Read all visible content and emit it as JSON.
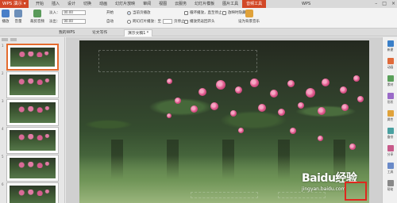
{
  "app": {
    "name": "WPS 演示",
    "wps_badge": "WPS"
  },
  "menu": {
    "tabs": [
      "开始",
      "插入",
      "设计",
      "切换",
      "动画",
      "幻灯片放映",
      "审阅",
      "视图",
      "云服务",
      "幻灯片模板",
      "图片工具",
      "音频工具"
    ],
    "active": "音频工具"
  },
  "ribbon": {
    "play": "播放",
    "volume": "音量",
    "trim": "裁剪音频",
    "fade_in_label": "淡入：",
    "fade_in_value": "00.00",
    "fade_out_label": "淡出：",
    "fade_out_value": "00.00",
    "start_label": "开始",
    "auto_label": "自动",
    "opt_current": "当前页播放",
    "opt_cross": "跨幻灯片播放：至",
    "pages_suffix": "页停止",
    "loop": "循环播放，直至停止",
    "hide": "放映时隐藏",
    "rewind": "播放完返回开头",
    "set_bgm": "设为背景音乐"
  },
  "doc_tabs": [
    "我的WPS",
    "论文写作",
    "演示文稿1 *"
  ],
  "active_doc_tab": "演示文稿1 *",
  "thumbs": {
    "numbers": [
      "1",
      "2",
      "3",
      "4",
      "5",
      "6"
    ],
    "selected": 0
  },
  "right_toolbar": [
    "新建",
    "动画",
    "素材",
    "形状",
    "属性",
    "备份",
    "分享",
    "工具",
    "帮助"
  ],
  "watermark": {
    "logo": "Baidu经验",
    "url": "jingyan.baidu.com"
  }
}
